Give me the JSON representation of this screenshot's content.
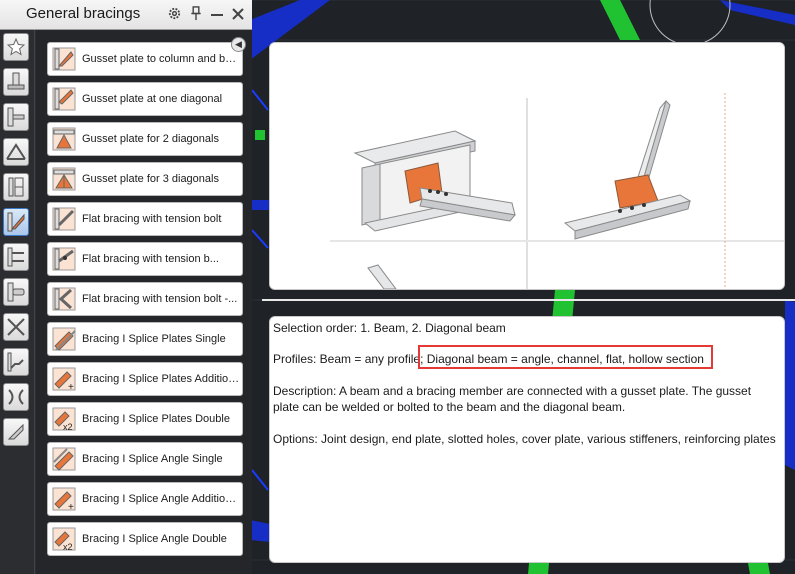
{
  "palette": {
    "title": "General bracings",
    "title_icons": [
      "gear-icon",
      "pin-icon",
      "minimize-icon",
      "close-icon"
    ],
    "categories": [
      {
        "name": "favorites-icon",
        "active": false
      },
      {
        "name": "base-plate-icon",
        "active": false
      },
      {
        "name": "beam-to-column-icon",
        "active": false
      },
      {
        "name": "roof-truss-icon",
        "active": false
      },
      {
        "name": "column-splice-icon",
        "active": false
      },
      {
        "name": "general-bracings-icon",
        "active": true
      },
      {
        "name": "beam-splice-icon",
        "active": false
      },
      {
        "name": "tube-connection-icon",
        "active": false
      },
      {
        "name": "cross-bracing-icon",
        "active": false
      },
      {
        "name": "stair-icon",
        "active": false
      },
      {
        "name": "clamp-icon",
        "active": false
      },
      {
        "name": "anchor-icon",
        "active": false
      }
    ],
    "items": [
      {
        "label": "Gusset plate to column and ba..."
      },
      {
        "label": "Gusset plate at one diagonal"
      },
      {
        "label": "Gusset plate for 2 diagonals"
      },
      {
        "label": "Gusset plate for 3 diagonals"
      },
      {
        "label": "Flat bracing with tension bolt"
      },
      {
        "label": "Flat bracing with tension b..."
      },
      {
        "label": "Flat bracing with tension bolt -..."
      },
      {
        "label": "Bracing I Splice Plates Single"
      },
      {
        "label": "Bracing I Splice Plates Addition..."
      },
      {
        "label": "Bracing I Splice Plates Double"
      },
      {
        "label": "Bracing I Splice Angle Single"
      },
      {
        "label": "Bracing I Splice Angle Addition..."
      },
      {
        "label": "Bracing I Splice Angle Double"
      }
    ]
  },
  "description": {
    "selection_order": "Selection order: 1. Beam, 2. Diagonal beam",
    "profiles_prefix": "Profiles: Beam = any profile;",
    "profiles_highlight": "Diagonal beam = angle, channel, flat, hollow section",
    "description_text": "Description: A beam and a bracing member are connected with a gusset plate.  The gusset plate can be welded or bolted to the beam and the diagonal beam.",
    "options_text": "Options: Joint design, end plate, slotted holes, cover plate, various stiffeners, reinforcing plates"
  },
  "colors": {
    "highlight": "#e53935",
    "accent": "#e8763a",
    "cad_blue": "#1530d8",
    "cad_green": "#21c232"
  }
}
